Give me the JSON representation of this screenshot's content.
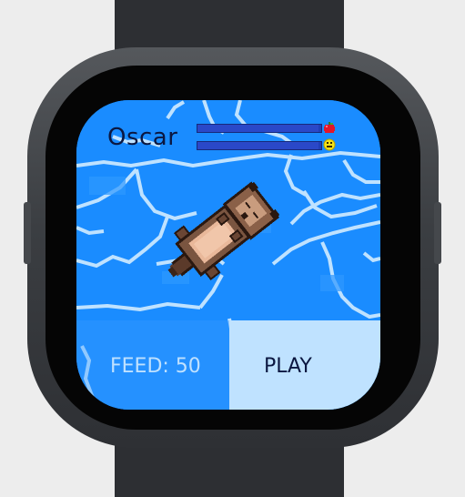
{
  "device": {
    "type": "smartwatch"
  },
  "pet": {
    "name": "Oscar",
    "food_level": 0.98,
    "mood_level": 0.98,
    "food_icon": "apple-icon",
    "mood_icon": "smiley-icon"
  },
  "actions": {
    "feed_label": "FEED: 50",
    "play_label": "PLAY"
  },
  "colors": {
    "water": "#1a8cff",
    "ripple": "#bfe2ff",
    "meter": "#213fb8",
    "text_dark": "#0b1740",
    "play_bg": "#bfe2ff"
  }
}
